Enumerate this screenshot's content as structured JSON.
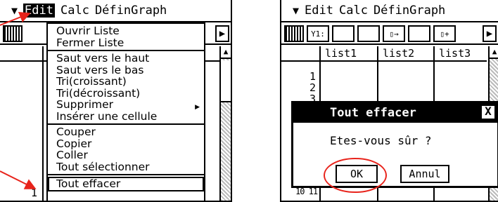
{
  "left_screen": {
    "menubar": {
      "arrow": "▼",
      "edit": "Edit",
      "calc": "Calc",
      "defin": "DéfinGraph"
    },
    "scroll_up": "▲",
    "play": "▶",
    "row_number": "1",
    "edit_menu": {
      "groups": [
        [
          "Ouvrir Liste",
          "Fermer Liste"
        ],
        [
          "Saut vers le haut",
          "Saut vers le bas",
          "Tri(croissant)",
          "Tri(décroissant)",
          "Supprimer",
          "Insérer une cellule"
        ],
        [
          "Couper",
          "Copier",
          "Coller",
          "Tout sélectionner"
        ],
        [
          "Tout effacer"
        ]
      ],
      "submenu_arrow": "▶"
    }
  },
  "right_screen": {
    "menubar": {
      "arrow": "▼",
      "edit": "Edit",
      "calc": "Calc",
      "defin": "DéfinGraph"
    },
    "toolbar_glyphs": [
      "Y1:",
      "",
      "",
      "▯→",
      "",
      "▯+",
      "▶"
    ],
    "columns": [
      "list1",
      "list2",
      "list3"
    ],
    "row_numbers": [
      "1",
      "2",
      "3"
    ],
    "scroll_up": "▲",
    "bottom_rows": "10 11",
    "dialog": {
      "title": "Tout effacer",
      "close": "X",
      "message": "Etes-vous sûr ?",
      "ok": "OK",
      "cancel": "Annul"
    }
  },
  "colors": {
    "annotation": "#e8231b"
  }
}
